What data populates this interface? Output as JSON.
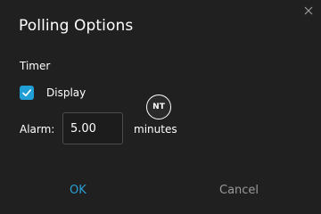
{
  "dialog": {
    "title": "Polling Options",
    "close_icon": "close-icon",
    "timer": {
      "section_label": "Timer",
      "display_checkbox": {
        "label": "Display",
        "checked": true,
        "check_color": "#1f9fd6"
      },
      "alarm": {
        "label": "Alarm:",
        "value": "5.00",
        "unit": "minutes"
      }
    },
    "buttons": {
      "ok_label": "OK",
      "cancel_label": "Cancel"
    },
    "watermark_text": "NT"
  },
  "colors": {
    "background": "#202020",
    "accent": "#2a9fd6",
    "muted_text": "#9a9a9a"
  }
}
